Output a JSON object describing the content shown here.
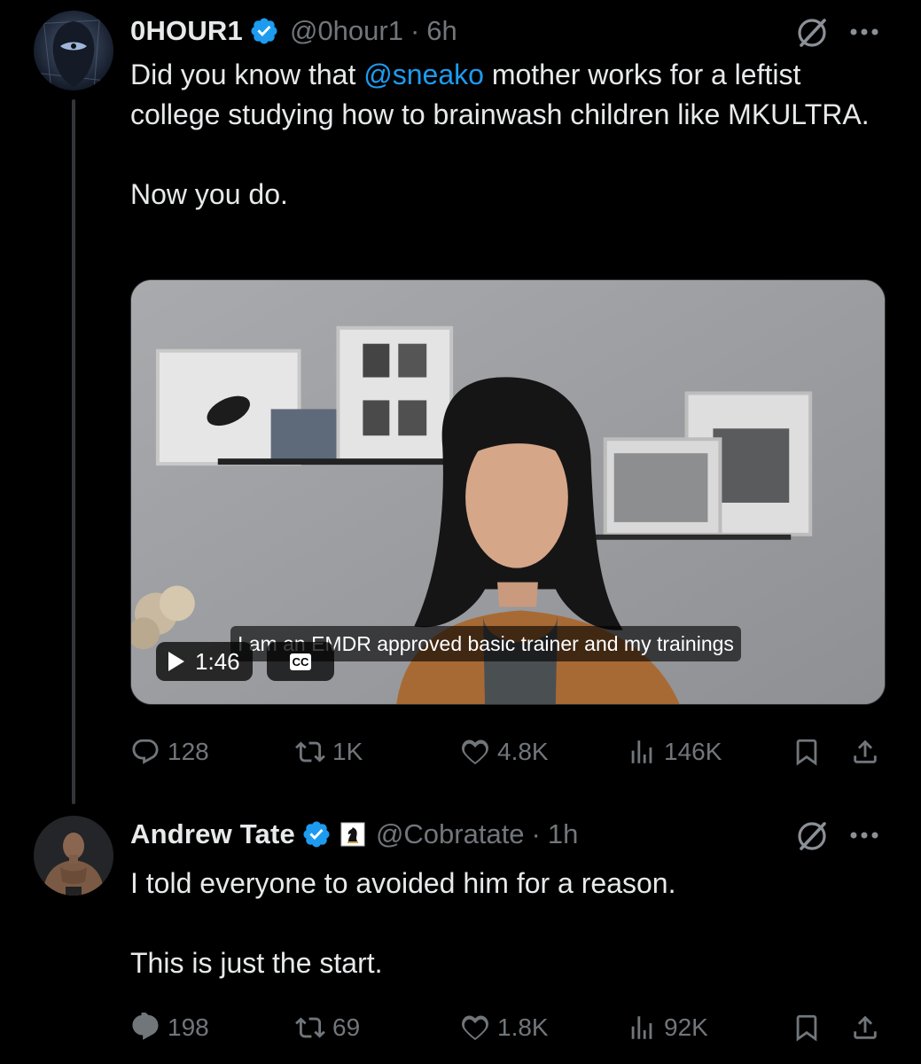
{
  "colors": {
    "background": "#000000",
    "text": "#e7e9ea",
    "muted": "#71767b",
    "link": "#1d9bf0",
    "verified": "#1d9bf0"
  },
  "posts": [
    {
      "author": {
        "display_name": "0HOUR1",
        "handle": "@0hour1",
        "time": "6h",
        "verified": true,
        "avatar_icon": "hooded-figure-avatar"
      },
      "text_lines": [
        {
          "before": "Did you know that ",
          "mention": "@sneako",
          "after": " mother works for a leftist college studying how to brainwash children like MKULTRA."
        },
        {
          "before": "",
          "mention": "",
          "after": ""
        },
        {
          "before": "Now you do.",
          "mention": "",
          "after": ""
        }
      ],
      "media": {
        "duration": "1:46",
        "cc_label": "CC",
        "caption": "I am an EMDR approved basic trainer and my trainings"
      },
      "stats": {
        "replies": "128",
        "reposts": "1K",
        "likes": "4.8K",
        "views": "146K"
      }
    },
    {
      "author": {
        "display_name": "Andrew Tate",
        "handle": "@Cobratate",
        "time": "1h",
        "verified": true,
        "affiliate_icon": "chess-knight-icon",
        "avatar_icon": "muscular-man-avatar"
      },
      "text_lines": [
        {
          "before": "I told everyone to avoided him for a reason.",
          "mention": "",
          "after": ""
        },
        {
          "before": "",
          "mention": "",
          "after": ""
        },
        {
          "before": "This is just the start.",
          "mention": "",
          "after": ""
        }
      ],
      "stats": {
        "replies": "198",
        "reposts": "69",
        "likes": "1.8K",
        "views": "92K"
      }
    }
  ],
  "separator": "·"
}
